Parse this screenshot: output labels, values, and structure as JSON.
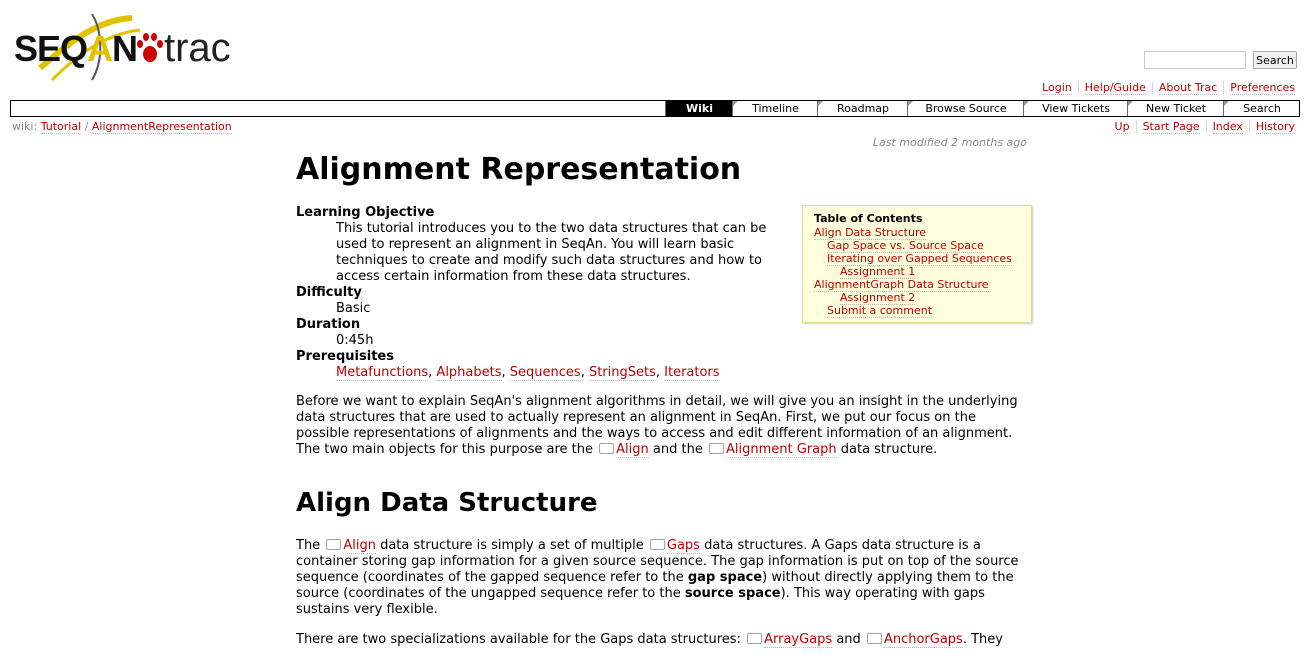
{
  "logo": {
    "seq": "SEQ",
    "a": "A",
    "n": "N",
    "trac": "trac"
  },
  "search": {
    "placeholder": "",
    "button": "Search"
  },
  "metanav": [
    "Login",
    "Help/Guide",
    "About Trac",
    "Preferences"
  ],
  "mainnav": [
    "Wiki",
    "Timeline",
    "Roadmap",
    "Browse Source",
    "View Tickets",
    "New Ticket",
    "Search"
  ],
  "breadcrumb": {
    "prefix": "wiki:",
    "parts": [
      "Tutorial",
      "AlignmentRepresentation"
    ],
    "sep": "/"
  },
  "ctxtnav": [
    "Up",
    "Start Page",
    "Index",
    "History"
  ],
  "last_modified": "Last modified 2 months ago",
  "title": "Alignment Representation",
  "meta": {
    "learning_objective_label": "Learning Objective",
    "learning_objective": "This tutorial introduces you to the two data structures that can be used to represent an alignment in SeqAn. You will learn basic techniques to create and modify such data structures and how to access certain information from these data structures.",
    "difficulty_label": "Difficulty",
    "difficulty": "Basic",
    "duration_label": "Duration",
    "duration": "0:45h",
    "prereq_label": "Prerequisites",
    "prereqs": [
      "Metafunctions",
      "Alphabets",
      "Sequences",
      "StringSets",
      "Iterators"
    ]
  },
  "toc": {
    "title": "Table of Contents",
    "items": [
      {
        "label": "Align Data Structure",
        "level": 1
      },
      {
        "label": "Gap Space vs. Source Space",
        "level": 2
      },
      {
        "label": "Iterating over Gapped Sequences",
        "level": 2
      },
      {
        "label": "Assignment 1",
        "level": 3
      },
      {
        "label": "AlignmentGraph Data Structure",
        "level": 1
      },
      {
        "label": "Assignment 2",
        "level": 3
      },
      {
        "label": "Submit a comment",
        "level": 2
      }
    ]
  },
  "intro": {
    "text1": "Before we want to explain SeqAn's alignment algorithms in detail, we will give you an insight in the underlying data structures that are used to actually represent an alignment in SeqAn. First, we put our focus on the possible representations of alignments and the ways to access and edit different information of an alignment. The two main objects for this purpose are the",
    "link1": "Align",
    "and": "and the",
    "link2": "Alignment Graph",
    "text2": "data structure."
  },
  "section1": {
    "heading": "Align Data Structure",
    "p1_a": "The",
    "p1_link1": "Align",
    "p1_b": "data structure is simply a set of multiple",
    "p1_link2": "Gaps",
    "p1_c": "data structures. A Gaps data structure is a container storing gap information for a given source sequence. The gap information is put on top of the source sequence (coordinates of the gapped sequence refer to the",
    "p1_bold1": "gap space",
    "p1_d": ") without directly applying them to the source (coordinates of the ungapped sequence refer to the",
    "p1_bold2": "source space",
    "p1_e": "). This way operating with gaps sustains very flexible.",
    "p2_a": "There are two specializations available for the Gaps data structures:",
    "p2_link1": "ArrayGaps",
    "p2_and": "and",
    "p2_link2": "AnchorGaps",
    "p2_b": ". They"
  }
}
